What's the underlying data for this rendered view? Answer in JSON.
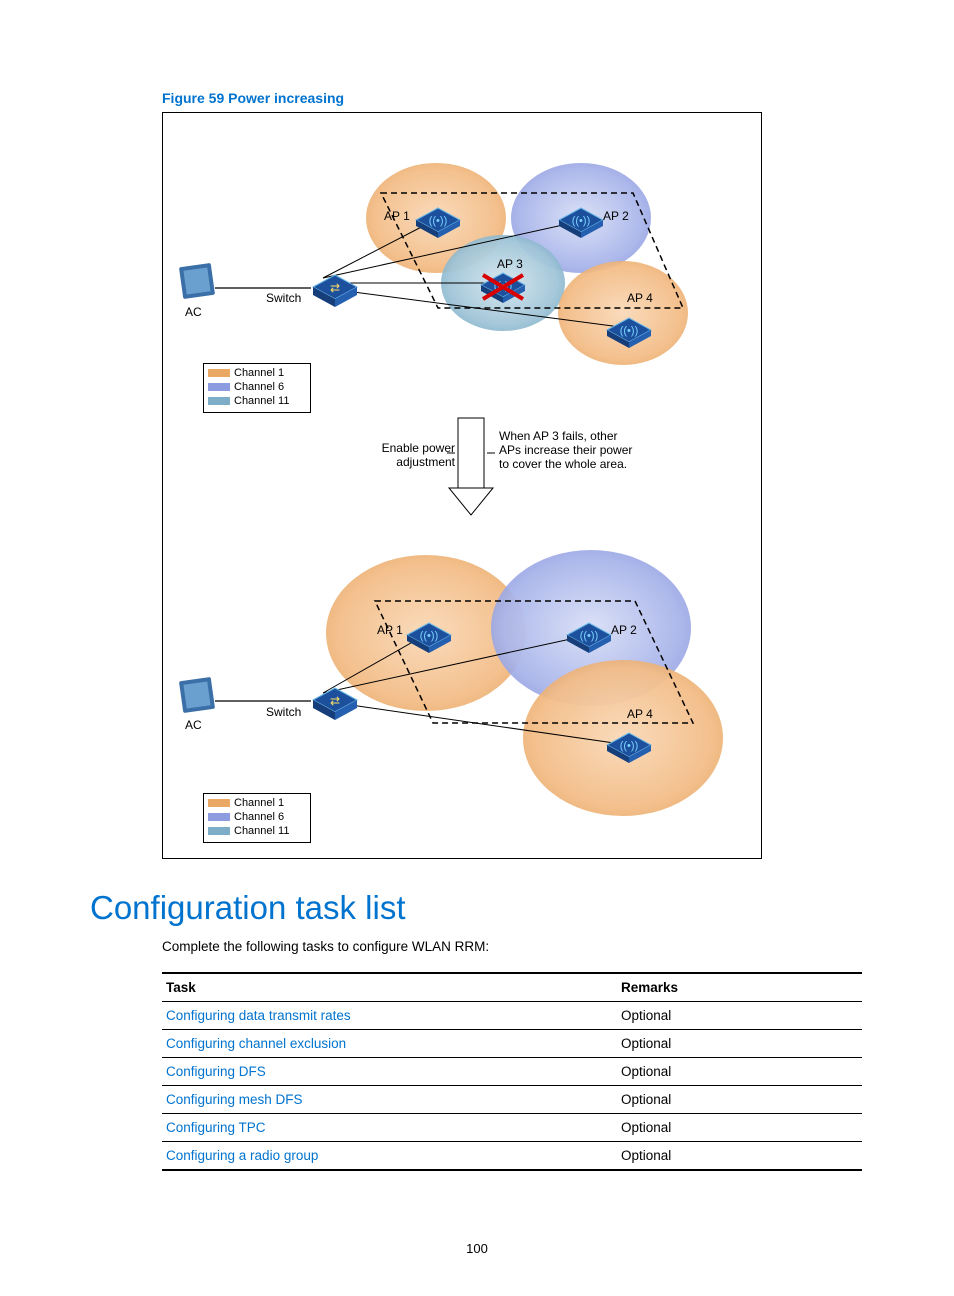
{
  "figure": {
    "caption": "Figure 59 Power increasing",
    "labels": {
      "ap1": "AP 1",
      "ap2": "AP 2",
      "ap3": "AP 3",
      "ap4": "AP 4",
      "switch": "Switch",
      "ac": "AC"
    },
    "legend": {
      "ch1": "Channel 1",
      "ch6": "Channel 6",
      "ch11": "Channel 11"
    },
    "callout_left": "Enable power adjustment",
    "callout_right": "When AP 3 fails, other APs increase their power to cover the whole area."
  },
  "heading": "Configuration task list",
  "intro": "Complete the following tasks to configure WLAN RRM:",
  "table": {
    "headers": {
      "task": "Task",
      "remarks": "Remarks"
    },
    "rows": [
      {
        "task": "Configuring data transmit rates",
        "remarks": "Optional"
      },
      {
        "task": "Configuring channel exclusion",
        "remarks": "Optional"
      },
      {
        "task": "Configuring DFS",
        "remarks": "Optional"
      },
      {
        "task": "Configuring mesh DFS",
        "remarks": "Optional"
      },
      {
        "task": "Configuring TPC",
        "remarks": "Optional"
      },
      {
        "task": "Configuring a radio group",
        "remarks": "Optional"
      }
    ]
  },
  "page_number": "100"
}
